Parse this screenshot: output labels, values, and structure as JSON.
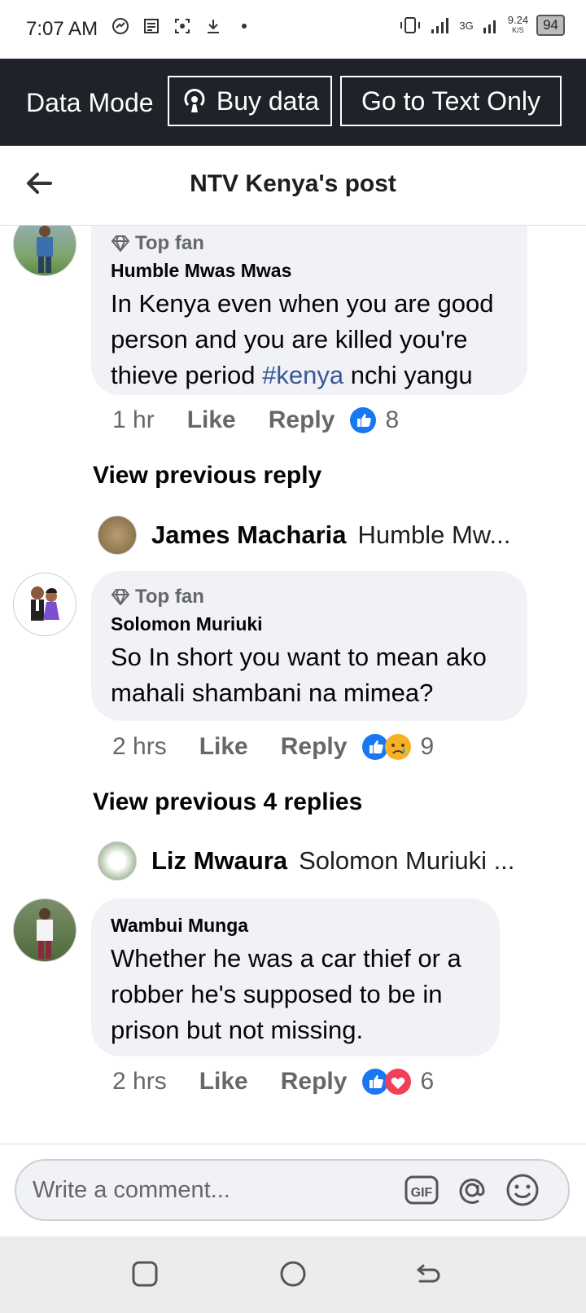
{
  "status_bar": {
    "time": "7:07 AM",
    "network": "3G",
    "speed": "9.24",
    "speed_unit": "K/S",
    "battery": "94",
    "icons": [
      "messenger-icon",
      "news-icon",
      "screenshot-icon",
      "download-icon",
      "dot-icon",
      "vibrate-icon",
      "signal-icon",
      "signal-3g-icon",
      "battery-icon"
    ]
  },
  "data_mode": {
    "label": "Data Mode",
    "buy_data": "Buy data",
    "text_only": "Go to Text Only"
  },
  "header": {
    "title": "NTV Kenya's post"
  },
  "comments": [
    {
      "top_fan": "Top fan",
      "author": "Humble Mwas Mwas",
      "text_lines": [
        "In Kenya even when you are good",
        "person and you are killed you're"
      ],
      "last_line_before": "thieve period ",
      "hashtag": "#kenya",
      "last_line_after": " nchi yangu",
      "time": "1 hr",
      "like": "Like",
      "reply": "Reply",
      "reaction_count": "8"
    },
    {
      "top_fan": "Top fan",
      "author": "Solomon Muriuki",
      "text_lines": [
        "So In short you want to mean ako",
        "mahali shambani na mimea?"
      ],
      "time": "2 hrs",
      "like": "Like",
      "reply": "Reply",
      "reaction_count": "9"
    },
    {
      "author": "Wambui Munga",
      "text_lines": [
        "Whether he was a car thief or a",
        "robber he's supposed to be in",
        "prison but not missing."
      ],
      "time": "2 hrs",
      "like": "Like",
      "reply": "Reply",
      "reaction_count": "6"
    }
  ],
  "view_previous": [
    "View previous reply",
    "View previous 4 replies"
  ],
  "reply_previews": [
    {
      "name": "James Macharia",
      "snippet": "Humble Mw..."
    },
    {
      "name": "Liz Mwaura",
      "snippet": "Solomon Muriuki ..."
    }
  ],
  "compose": {
    "placeholder": "Write a comment...",
    "gif_label": "GIF"
  },
  "colors": {
    "data_bar": "#1f2329",
    "bubble": "#f0f2f5",
    "like_blue": "#1877f2",
    "love_red": "#f33e58",
    "hashtag": "#385898"
  }
}
